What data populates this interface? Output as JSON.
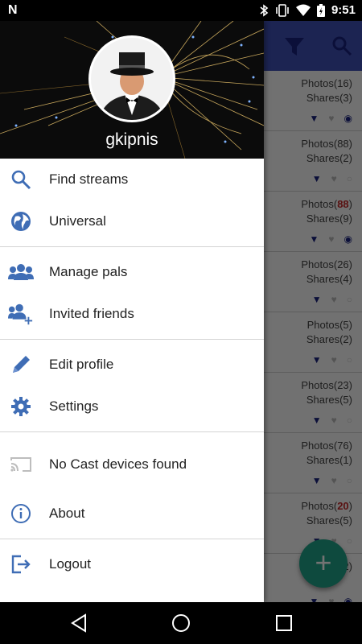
{
  "status_bar": {
    "carrier_icon": "N",
    "time": "9:51",
    "icons": [
      "bluetooth-icon",
      "vibrate-icon",
      "wifi-icon",
      "battery-charging-icon"
    ]
  },
  "background_app": {
    "rows": [
      {
        "photos_label": "Photos",
        "photos": "16",
        "photos_hot": false,
        "shares_label": "Shares",
        "shares": "3",
        "watched": true
      },
      {
        "photos_label": "Photos",
        "photos": "88",
        "photos_hot": false,
        "shares_label": "Shares",
        "shares": "2",
        "watched": false
      },
      {
        "photos_label": "Photos",
        "photos": "88",
        "photos_hot": true,
        "shares_label": "Shares",
        "shares": "9",
        "watched": true
      },
      {
        "photos_label": "Photos",
        "photos": "26",
        "photos_hot": false,
        "shares_label": "Shares",
        "shares": "4",
        "watched": false
      },
      {
        "photos_label": "Photos",
        "photos": "5",
        "photos_hot": false,
        "shares_label": "Shares",
        "shares": "2",
        "watched": false
      },
      {
        "photos_label": "Photos",
        "photos": "23",
        "photos_hot": false,
        "shares_label": "Shares",
        "shares": "5",
        "watched": false
      },
      {
        "photos_label": "Photos",
        "photos": "76",
        "photos_hot": false,
        "shares_label": "Shares",
        "shares": "1",
        "watched": false
      },
      {
        "photos_label": "Photos",
        "photos": "20",
        "photos_hot": true,
        "shares_label": "Shares",
        "shares": "5",
        "watched": false
      },
      {
        "photos_label": "",
        "photos": "",
        "photos_hot": false,
        "shares_label": "",
        "shares": "2",
        "watched": true
      }
    ],
    "fab_icon": "+"
  },
  "drawer": {
    "username": "gkipnis",
    "items": [
      {
        "label": "Find streams",
        "icon": "search-icon"
      },
      {
        "label": "Universal",
        "icon": "globe-icon"
      },
      {
        "label": "Manage pals",
        "icon": "group-icon"
      },
      {
        "label": "Invited friends",
        "icon": "add-group-icon"
      },
      {
        "label": "Edit profile",
        "icon": "pencil-icon"
      },
      {
        "label": "Settings",
        "icon": "gear-icon"
      },
      {
        "label": "No Cast devices found",
        "icon": "cast-icon"
      },
      {
        "label": "About",
        "icon": "info-icon"
      },
      {
        "label": "Logout",
        "icon": "logout-icon"
      }
    ]
  },
  "colors": {
    "accent_blue": "#3f6db5",
    "app_bar": "#3f51b5",
    "fab": "#1fa58a",
    "hot_count": "#c62828"
  }
}
